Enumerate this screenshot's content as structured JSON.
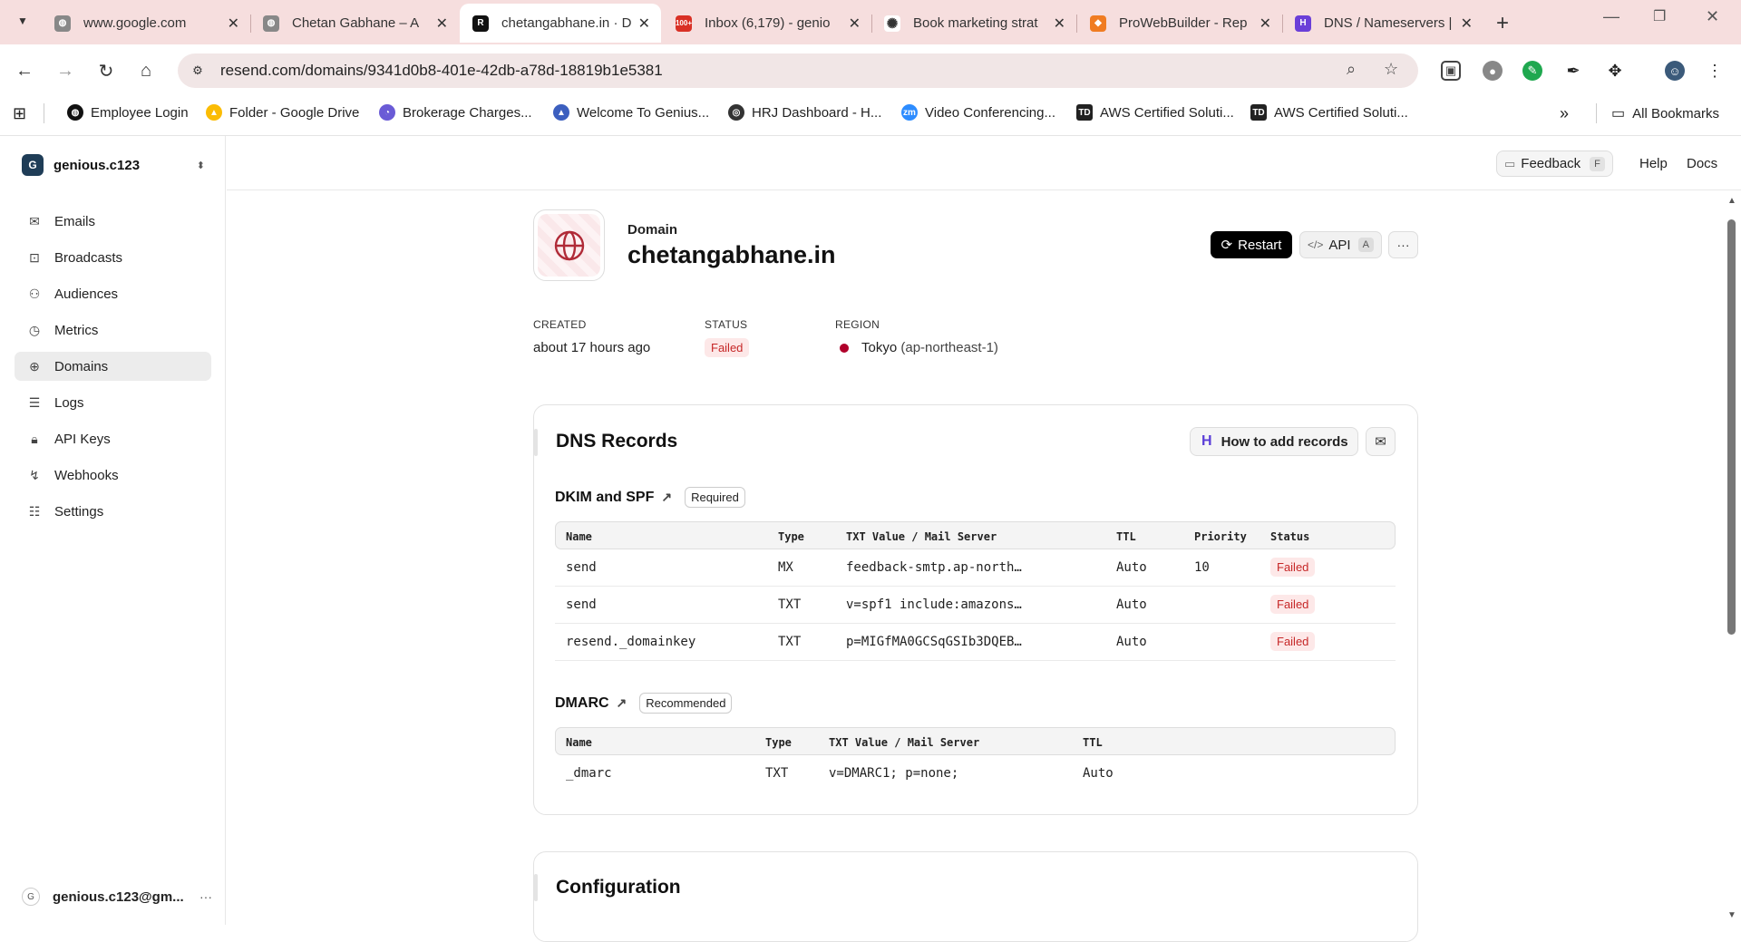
{
  "browser": {
    "tabs": [
      {
        "title": "www.google.com",
        "favicon": "globe-icon"
      },
      {
        "title": "Chetan Gabhane – A",
        "favicon": "globe-icon"
      },
      {
        "title": "chetangabhane.in · D",
        "favicon": "resend-icon",
        "active": true
      },
      {
        "title": "Inbox (6,179) - genio",
        "favicon": "gmail-icon",
        "badge": "100+"
      },
      {
        "title": "Book marketing strat",
        "favicon": "openai-icon"
      },
      {
        "title": "ProWebBuilder - Rep",
        "favicon": "prowebbuilder-icon"
      },
      {
        "title": "DNS / Nameservers |",
        "favicon": "hostinger-icon"
      }
    ],
    "url": "resend.com/domains/9341d0b8-401e-42db-a78d-18819b1e5381",
    "bookmarks": [
      {
        "label": "Employee Login"
      },
      {
        "label": "Folder - Google Drive"
      },
      {
        "label": "Brokerage Charges..."
      },
      {
        "label": "Welcome To Genius..."
      },
      {
        "label": "HRJ Dashboard - H..."
      },
      {
        "label": "Video Conferencing..."
      },
      {
        "label": "AWS Certified Soluti..."
      },
      {
        "label": "AWS Certified Soluti..."
      }
    ],
    "all_bookmarks": "All Bookmarks"
  },
  "sidebar": {
    "team_initial": "G",
    "team_name": "genious.c123",
    "items": [
      {
        "label": "Emails",
        "icon": "mail-icon"
      },
      {
        "label": "Broadcasts",
        "icon": "broadcast-icon"
      },
      {
        "label": "Audiences",
        "icon": "users-icon"
      },
      {
        "label": "Metrics",
        "icon": "chart-icon"
      },
      {
        "label": "Domains",
        "icon": "globe-icon",
        "selected": true
      },
      {
        "label": "Logs",
        "icon": "list-icon"
      },
      {
        "label": "API Keys",
        "icon": "lock-icon"
      },
      {
        "label": "Webhooks",
        "icon": "webhook-icon"
      },
      {
        "label": "Settings",
        "icon": "settings-icon"
      }
    ],
    "account_initial": "G",
    "account": "genious.c123@gm..."
  },
  "topbar": {
    "feedback": "Feedback",
    "feedback_key": "F",
    "help": "Help",
    "docs": "Docs"
  },
  "domain": {
    "label": "Domain",
    "name": "chetangabhane.in",
    "restart": "Restart",
    "api": "API",
    "api_key": "A",
    "more": "···",
    "created_label": "CREATED",
    "created_value": "about 17 hours ago",
    "status_label": "STATUS",
    "status_value": "Failed",
    "region_label": "REGION",
    "region_value": "Tokyo",
    "region_code": "(ap-northeast-1)"
  },
  "dns": {
    "title": "DNS Records",
    "how_to": "How to add records",
    "dkim_title": "DKIM and SPF",
    "dkim_pill": "Required",
    "dkim_headers": [
      "Name",
      "Type",
      "TXT Value / Mail Server",
      "TTL",
      "Priority",
      "Status"
    ],
    "dkim_rows": [
      {
        "name": "send",
        "type": "MX",
        "value": "feedback-smtp.ap-north…",
        "ttl": "Auto",
        "priority": "10",
        "status": "Failed"
      },
      {
        "name": "send",
        "type": "TXT",
        "value": "v=spf1 include:amazons…",
        "ttl": "Auto",
        "priority": "",
        "status": "Failed"
      },
      {
        "name": "resend._domainkey",
        "type": "TXT",
        "value": "p=MIGfMA0GCSqGSIb3DQEB…",
        "ttl": "Auto",
        "priority": "",
        "status": "Failed"
      }
    ],
    "dmarc_title": "DMARC",
    "dmarc_pill": "Recommended",
    "dmarc_headers": [
      "Name",
      "Type",
      "TXT Value / Mail Server",
      "TTL"
    ],
    "dmarc_rows": [
      {
        "name": "_dmarc",
        "type": "TXT",
        "value": "v=DMARC1; p=none;",
        "ttl": "Auto"
      }
    ]
  },
  "configuration": {
    "title": "Configuration"
  },
  "colors": {
    "accent": "#000000",
    "failed_bg": "#fde8e8",
    "failed_text": "#c62828",
    "tab_bar": "#f6dede",
    "region_dot": "#b0002b"
  }
}
